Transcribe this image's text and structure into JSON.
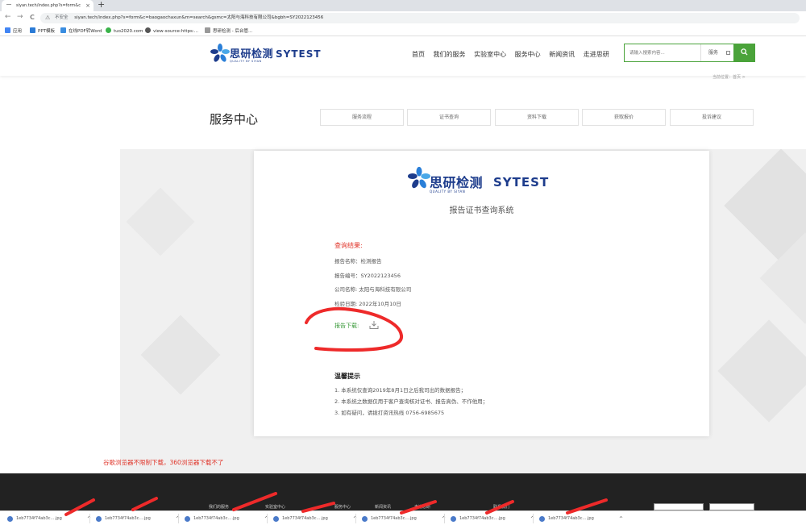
{
  "browser": {
    "tab_title": "siyan.tech/index.php?s=form&c",
    "tab_close": "×",
    "new_tab": "+",
    "back": "←",
    "forward": "→",
    "reload": "C",
    "insecure_label": "不安全",
    "url": "siyan.tech/index.php?s=form&c=baogaochaxun&m=search&gsmc=太阳与海科技有限公司&bgbh=SY2022123456",
    "bookmarks": [
      "应用",
      "PPT模板",
      "在线PDF转Word",
      "tuo2020.com",
      "view-source:https:...",
      "思研检测 - 后台管..."
    ]
  },
  "header": {
    "logo_cn": "思研检测",
    "logo_en": "SYTEST",
    "logo_sub": "QUALITY BY SIYAN",
    "nav": [
      "首页",
      "我们的服务",
      "实验室中心",
      "服务中心",
      "新闻资讯",
      "走进思研"
    ],
    "search_placeholder": "请输入搜索内容...",
    "search_scope": "服务",
    "search_icon": "search-icon"
  },
  "breadcrumb": "当前位置：首页 >",
  "service": {
    "title": "服务中心",
    "tabs": [
      "服务流程",
      "证书查询",
      "资料下载",
      "获取报价",
      "投诉建议"
    ]
  },
  "card": {
    "logo_cn": "思研检测",
    "logo_en": "SYTEST",
    "logo_sub": "QUALITY BY SIYAN",
    "system_title": "报告证书查询系统",
    "result_label": "查询结果:",
    "rows": [
      "报告名称：检测报告",
      "报告编号：SY2022123456",
      "公司名称: 太阳与海科技有限公司",
      "检验日期: 2022年10月10日"
    ],
    "download_label": "报告下载:",
    "download_icon": "download-icon",
    "tips_title": "温馨提示",
    "tips": [
      "1. 本系统仅查询2019年8月1日之后我司出的数据报告；",
      "2. 本系统之数据仅用于客户查询核对证书、报告真伪、不作他用；",
      "3. 如有疑问，请拨打资讯热线 0756-6985675"
    ]
  },
  "note": "谷歌浏览器不限制下载，360浏览器下载不了",
  "footer": {
    "items": [
      "我们的服务",
      "实验室中心",
      "服务中心",
      "新闻资讯",
      "走进思研",
      "联系我们"
    ]
  },
  "downloads": {
    "file": "1eb7734f74ab3c….jpg",
    "count": 7,
    "chevron": "^"
  },
  "colors": {
    "brand_blue": "#1d3c8c",
    "accent_green": "#4aa33a",
    "alert_red": "#e0362b",
    "footer_bg": "#222222"
  }
}
